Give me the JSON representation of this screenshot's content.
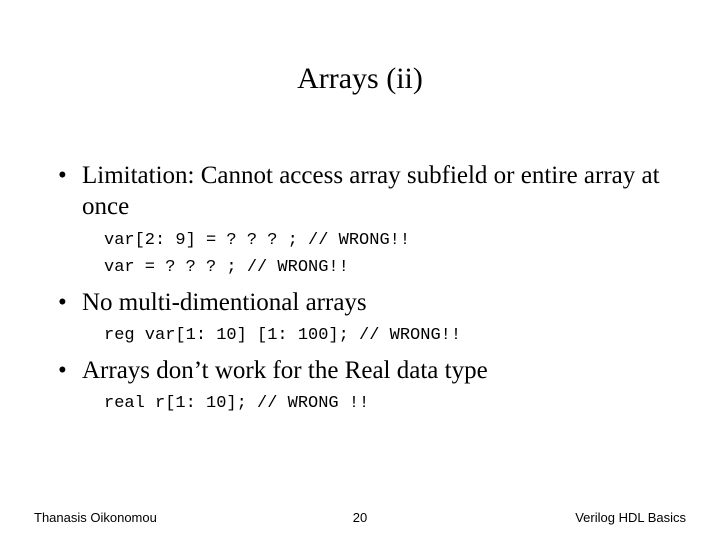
{
  "title": "Arrays (ii)",
  "bullet_char": "•",
  "bullets": [
    {
      "text": "Limitation: Cannot access array subfield or entire array at once"
    },
    {
      "text": "No multi-dimentional arrays"
    },
    {
      "text": "Arrays don’t work for the Real data type"
    }
  ],
  "code": {
    "c1": "var[2: 9] = ? ? ? ; // WRONG!!",
    "c2": "var = ? ? ? ; // WRONG!!",
    "c3": "reg var[1: 10] [1: 100]; // WRONG!!",
    "c4": "real r[1: 10]; // WRONG !!"
  },
  "footer": {
    "left": "Thanasis Oikonomou",
    "center": "20",
    "right": "Verilog HDL Basics"
  }
}
